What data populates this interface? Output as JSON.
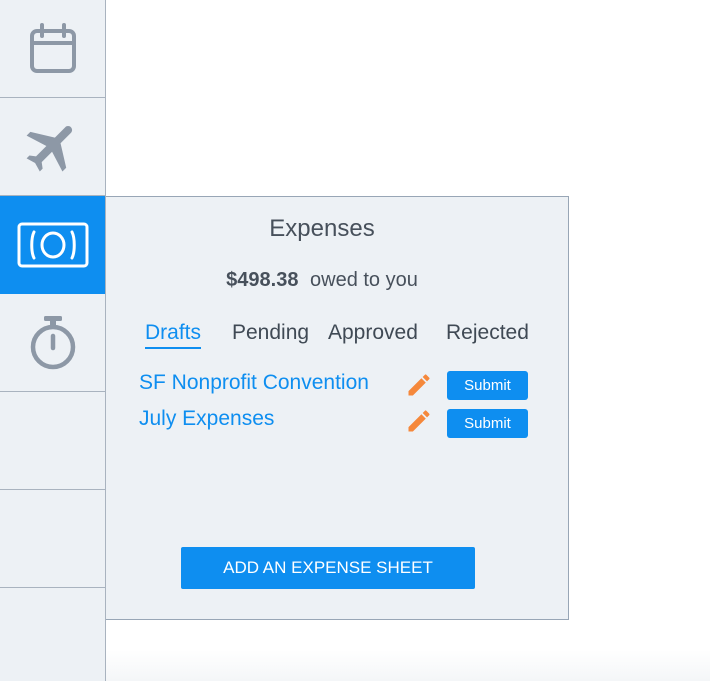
{
  "sidebar": {
    "items": [
      {
        "icon": "calendar-icon",
        "active": false
      },
      {
        "icon": "airplane-icon",
        "active": false
      },
      {
        "icon": "money-icon",
        "active": true
      },
      {
        "icon": "stopwatch-icon",
        "active": false
      },
      {
        "icon": "",
        "active": false
      },
      {
        "icon": "",
        "active": false
      },
      {
        "icon": "",
        "active": false
      }
    ]
  },
  "expenses": {
    "title": "Expenses",
    "amount": "$498.38",
    "owed_text": "owed to you",
    "tabs": [
      {
        "label": "Drafts",
        "active": true
      },
      {
        "label": "Pending",
        "active": false
      },
      {
        "label": "Approved",
        "active": false
      },
      {
        "label": "Rejected",
        "active": false
      }
    ],
    "items": [
      {
        "name": "SF Nonprofit Convention",
        "action": "Submit"
      },
      {
        "name": "July Expenses",
        "action": "Submit"
      }
    ],
    "add_button": "ADD AN EXPENSE SHEET"
  },
  "colors": {
    "accent": "#0e8ef0",
    "edit_icon": "#f5883b",
    "sidebar_bg": "#edf1f5",
    "icon_gray": "#8d98a6",
    "text_dark": "#47505b"
  }
}
